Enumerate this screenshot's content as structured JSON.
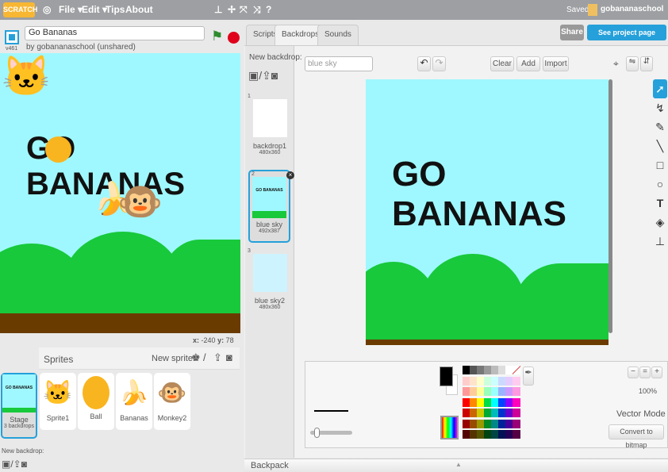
{
  "topbar": {
    "logo": "SCRATCH",
    "menus": [
      "File ▾",
      "Edit ▾",
      "Tips",
      "About"
    ],
    "saved": "Saved",
    "user": "gobananaschool"
  },
  "project": {
    "title": "Go Bananas",
    "byline": "by gobananaschool (unshared)",
    "version": "v461"
  },
  "stage": {
    "title": "GO BANANAS",
    "x_label": "x:",
    "x": "-240",
    "y_label": "y:",
    "y": "78"
  },
  "sprites": {
    "header": "Sprites",
    "new_sprite": "New sprite:",
    "items": [
      {
        "name": "Sprite1"
      },
      {
        "name": "Ball"
      },
      {
        "name": "Bananas"
      },
      {
        "name": "Monkey2"
      }
    ],
    "stage_label": "Stage",
    "stage_count": "3 backdrops",
    "new_backdrop": "New backdrop:"
  },
  "tabs": [
    "Scripts",
    "Backdrops",
    "Sounds"
  ],
  "actions": {
    "share": "Share",
    "see_page": "See project page"
  },
  "backdrops": {
    "new_backdrop": "New backdrop:",
    "items": [
      {
        "num": "1",
        "name": "backdrop1",
        "size": "480x360"
      },
      {
        "num": "2",
        "name": "blue sky",
        "size": "492x387"
      },
      {
        "num": "3",
        "name": "blue sky2",
        "size": "480x360"
      }
    ]
  },
  "editor": {
    "name_value": "blue sky",
    "clear": "Clear",
    "add": "Add",
    "import": "Import",
    "canvas_text": "GO BANANAS",
    "zoom": "100%",
    "mode": "Vector Mode",
    "convert": "Convert to bitmap"
  },
  "palette": [
    "#000000",
    "#555555",
    "#777777",
    "#999999",
    "#bbbbbb",
    "#dddddd",
    "#ffffff",
    "none",
    "#ffcccc",
    "#ffe4cc",
    "#ffffcc",
    "#ccffdd",
    "#ccffff",
    "#ccd9ff",
    "#e4ccff",
    "#ffccf0",
    "#ff9999",
    "#ffcc99",
    "#ffff99",
    "#99ffbb",
    "#99ffff",
    "#99b3ff",
    "#cc99ff",
    "#ff99e0",
    "#ff0000",
    "#ff8800",
    "#ffff00",
    "#00dd44",
    "#00ffff",
    "#0044ff",
    "#8800ff",
    "#ff00bb",
    "#cc0000",
    "#cc6600",
    "#cccc00",
    "#00aa33",
    "#00bbbb",
    "#0033cc",
    "#6600cc",
    "#cc0099",
    "#990000",
    "#994c00",
    "#999900",
    "#008822",
    "#008888",
    "#002299",
    "#440099",
    "#990077",
    "#550000",
    "#553300",
    "#555500",
    "#004411",
    "#004444",
    "#001155",
    "#220055",
    "#550044"
  ],
  "backpack": "Backpack",
  "colors": {
    "accent": "#25a0da",
    "sky": "#9ff8ff",
    "grass": "#18c93b",
    "ground": "#6a3b00"
  }
}
